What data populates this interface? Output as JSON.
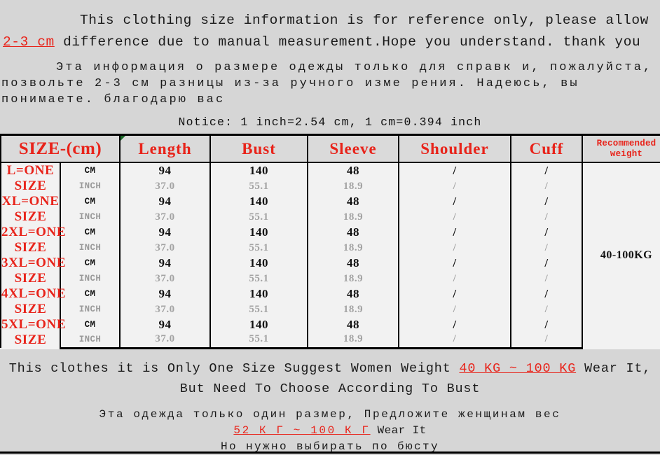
{
  "top_notice_en": {
    "part1": "This clothing size information is for reference only, please allow ",
    "highlight": "2-3 cm",
    "part2": " difference due to manual measurement.Hope you understand. thank you"
  },
  "top_notice_ru": {
    "line1": "Эта информация о размере одежды только для справк",
    "line2": "и, пожалуйста, позвольте 2-3 см разницы из-за ручного изме",
    "line3": "рения. Надеюсь, вы понимаете.",
    "line4": "благодарю вас"
  },
  "conversion_notice": "Notice: 1 inch=2.54 cm,  1 cm=0.394 inch",
  "table": {
    "headers": [
      "SIZE-(cm)",
      "Length",
      "Bust",
      "Sleeve",
      "Shoulder",
      "Cuff"
    ],
    "weight_header_line1": "Recommended",
    "weight_header_line2": "weight",
    "unit_cm": "CM",
    "unit_inch": "INCH",
    "recommended_weight": "40-100KG",
    "rows": [
      {
        "size": "L=ONE SIZE",
        "cm": {
          "length": "94",
          "bust": "140",
          "sleeve": "48",
          "shoulder": "/",
          "cuff": "/"
        },
        "inch": {
          "length": "37.0",
          "bust": "55.1",
          "sleeve": "18.9",
          "shoulder": "/",
          "cuff": "/"
        }
      },
      {
        "size": "XL=ONE SIZE",
        "cm": {
          "length": "94",
          "bust": "140",
          "sleeve": "48",
          "shoulder": "/",
          "cuff": "/"
        },
        "inch": {
          "length": "37.0",
          "bust": "55.1",
          "sleeve": "18.9",
          "shoulder": "/",
          "cuff": "/"
        }
      },
      {
        "size": "2XL=ONE SIZE",
        "cm": {
          "length": "94",
          "bust": "140",
          "sleeve": "48",
          "shoulder": "/",
          "cuff": "/"
        },
        "inch": {
          "length": "37.0",
          "bust": "55.1",
          "sleeve": "18.9",
          "shoulder": "/",
          "cuff": "/"
        }
      },
      {
        "size": "3XL=ONE SIZE",
        "cm": {
          "length": "94",
          "bust": "140",
          "sleeve": "48",
          "shoulder": "/",
          "cuff": "/"
        },
        "inch": {
          "length": "37.0",
          "bust": "55.1",
          "sleeve": "18.9",
          "shoulder": "/",
          "cuff": "/"
        }
      },
      {
        "size": "4XL=ONE SIZE",
        "cm": {
          "length": "94",
          "bust": "140",
          "sleeve": "48",
          "shoulder": "/",
          "cuff": "/"
        },
        "inch": {
          "length": "37.0",
          "bust": "55.1",
          "sleeve": "18.9",
          "shoulder": "/",
          "cuff": "/"
        }
      },
      {
        "size": "5XL=ONE SIZE",
        "cm": {
          "length": "94",
          "bust": "140",
          "sleeve": "48",
          "shoulder": "/",
          "cuff": "/"
        },
        "inch": {
          "length": "37.0",
          "bust": "55.1",
          "sleeve": "18.9",
          "shoulder": "/",
          "cuff": "/"
        }
      }
    ]
  },
  "bottom_notice_en": {
    "part1": "This clothes it is Only One Size Suggest Women Weight ",
    "highlight": "40 KG ~ 100 KG",
    "part2": " Wear It,",
    "line2": "But Need To Choose According To Bust"
  },
  "bottom_notice_ru": {
    "line1": "Эта одежда только один размер, Предложите женщинам вес",
    "line2_highlight": "52 К Г ~ 100 К Г",
    "line2_plain": " Wear It",
    "line3": "Но нужно выбирать по бюсту"
  },
  "colors": {
    "accent_red": "#e8231a",
    "page_background": "#d6d6d6",
    "cell_background": "#f2f2f2",
    "header_background": "#dadada",
    "inch_text": "#a3a3a3",
    "comment_marker_green": "#1d6b2a"
  }
}
